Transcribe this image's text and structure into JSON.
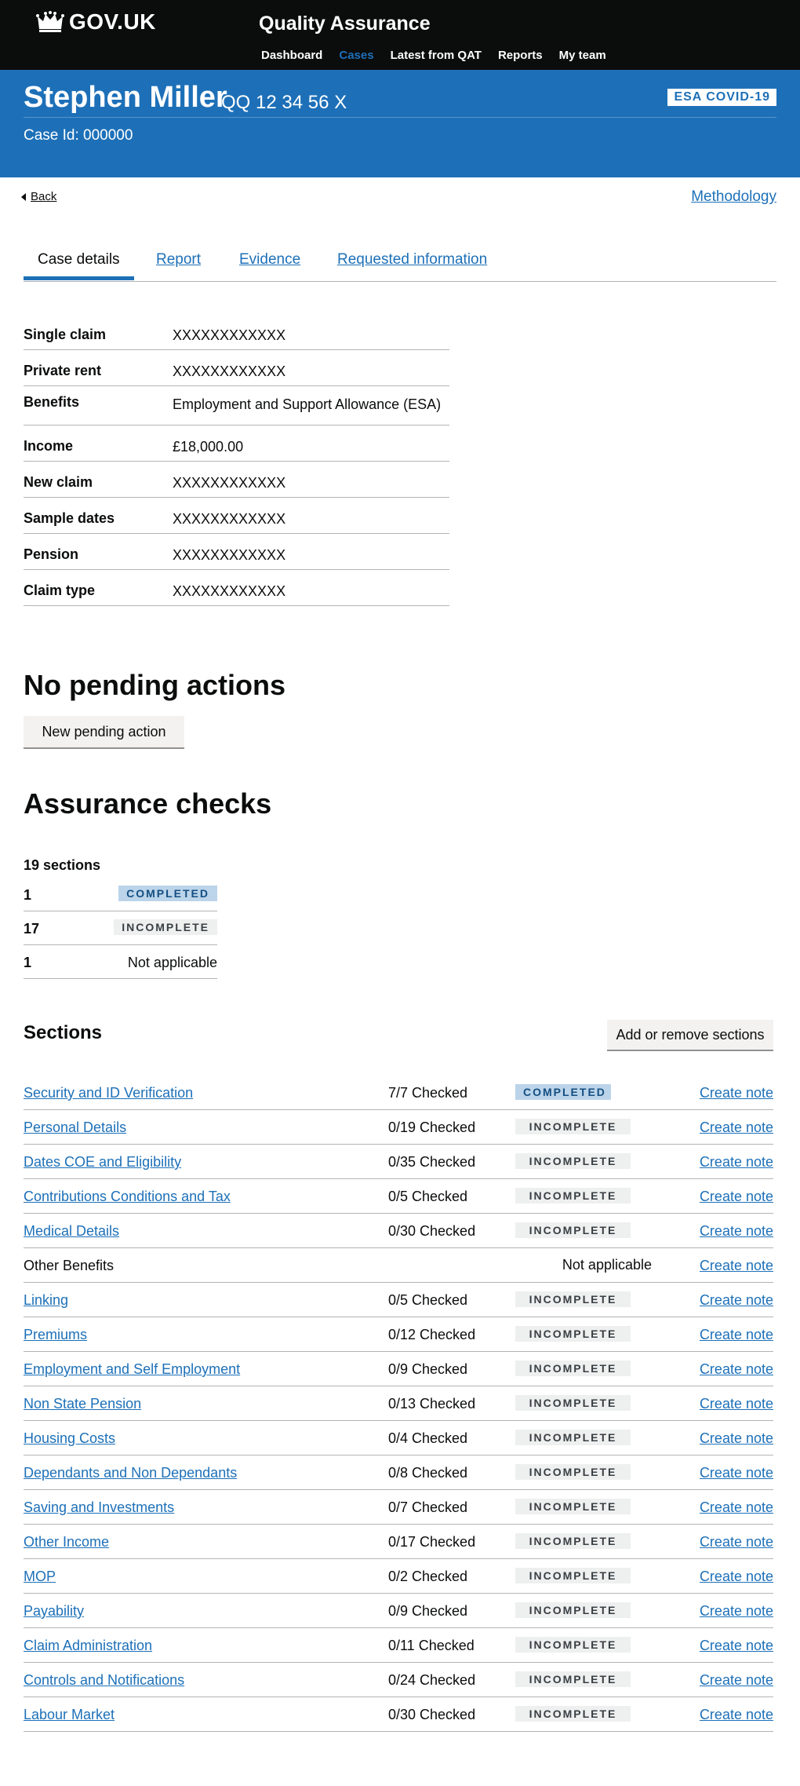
{
  "header": {
    "logo_text": "GOV.UK",
    "service_name": "Quality Assurance",
    "nav": [
      "Dashboard",
      "Cases",
      "Latest from QAT",
      "Reports",
      "My team"
    ],
    "active_nav": "Cases"
  },
  "banner": {
    "name": "Stephen Miller",
    "nino": "QQ 12 34 56 X",
    "tag": "ESA COVID-19",
    "case_id": "Case Id: 000000"
  },
  "links": {
    "back": "Back",
    "methodology": "Methodology"
  },
  "tabs": [
    "Case details",
    "Report",
    "Evidence",
    "Requested information"
  ],
  "summary": [
    {
      "key": "Single claim",
      "value": "XXXXXXXXXXXX"
    },
    {
      "key": "Private rent",
      "value": "XXXXXXXXXXXX"
    },
    {
      "key": "Benefits",
      "value": "Employment and Support Allowance (ESA)"
    },
    {
      "key": "Income",
      "value": "£18,000.00"
    },
    {
      "key": "New claim",
      "value": "XXXXXXXXXXXX"
    },
    {
      "key": "Sample dates",
      "value": "XXXXXXXXXXXX"
    },
    {
      "key": "Pension",
      "value": "XXXXXXXXXXXX"
    },
    {
      "key": "Claim type",
      "value": "XXXXXXXXXXXX"
    }
  ],
  "pending": {
    "heading": "No pending actions",
    "button": "New pending action"
  },
  "assurance": {
    "heading": "Assurance checks",
    "total": "19 sections",
    "counts": [
      {
        "n": "1",
        "status": "COMPLETED"
      },
      {
        "n": "17",
        "status": "INCOMPLETE"
      },
      {
        "n": "1",
        "status": "Not applicable"
      }
    ]
  },
  "sections": {
    "heading": "Sections",
    "button": "Add or remove sections",
    "create_note": "Create note",
    "rows": [
      {
        "name": "Security and ID Verification",
        "checked": "7/7 Checked",
        "status": "COMPLETED"
      },
      {
        "name": "Personal Details",
        "checked": "0/19 Checked",
        "status": "INCOMPLETE"
      },
      {
        "name": "Dates COE and Eligibility",
        "checked": "0/35 Checked",
        "status": "INCOMPLETE"
      },
      {
        "name": "Contributions Conditions and Tax",
        "checked": "0/5 Checked",
        "status": "INCOMPLETE"
      },
      {
        "name": "Medical Details",
        "checked": "0/30 Checked",
        "status": "INCOMPLETE"
      },
      {
        "name": "Other Benefits",
        "checked": "",
        "status": "Not applicable"
      },
      {
        "name": "Linking",
        "checked": "0/5 Checked",
        "status": "INCOMPLETE"
      },
      {
        "name": "Premiums",
        "checked": "0/12 Checked",
        "status": "INCOMPLETE"
      },
      {
        "name": "Employment and Self Employment",
        "checked": "0/9 Checked",
        "status": "INCOMPLETE"
      },
      {
        "name": "Non State Pension",
        "checked": "0/13 Checked",
        "status": "INCOMPLETE"
      },
      {
        "name": "Housing Costs",
        "checked": "0/4 Checked",
        "status": "INCOMPLETE"
      },
      {
        "name": "Dependants and Non Dependants",
        "checked": "0/8 Checked",
        "status": "INCOMPLETE"
      },
      {
        "name": "Saving and Investments",
        "checked": "0/7 Checked",
        "status": "INCOMPLETE"
      },
      {
        "name": "Other Income",
        "checked": "0/17 Checked",
        "status": "INCOMPLETE"
      },
      {
        "name": "MOP",
        "checked": "0/2 Checked",
        "status": "INCOMPLETE"
      },
      {
        "name": "Payability",
        "checked": "0/9 Checked",
        "status": "INCOMPLETE"
      },
      {
        "name": "Claim Administration",
        "checked": "0/11 Checked",
        "status": "INCOMPLETE"
      },
      {
        "name": "Controls and Notifications",
        "checked": "0/24 Checked",
        "status": "INCOMPLETE"
      },
      {
        "name": "Labour Market",
        "checked": "0/30 Checked",
        "status": "INCOMPLETE"
      }
    ]
  },
  "colors": {
    "header_bg": "#0b0c0c",
    "brand_blue": "#1d70b8",
    "completed_bg": "#bbd4ea",
    "incomplete_bg": "#eeefef"
  }
}
